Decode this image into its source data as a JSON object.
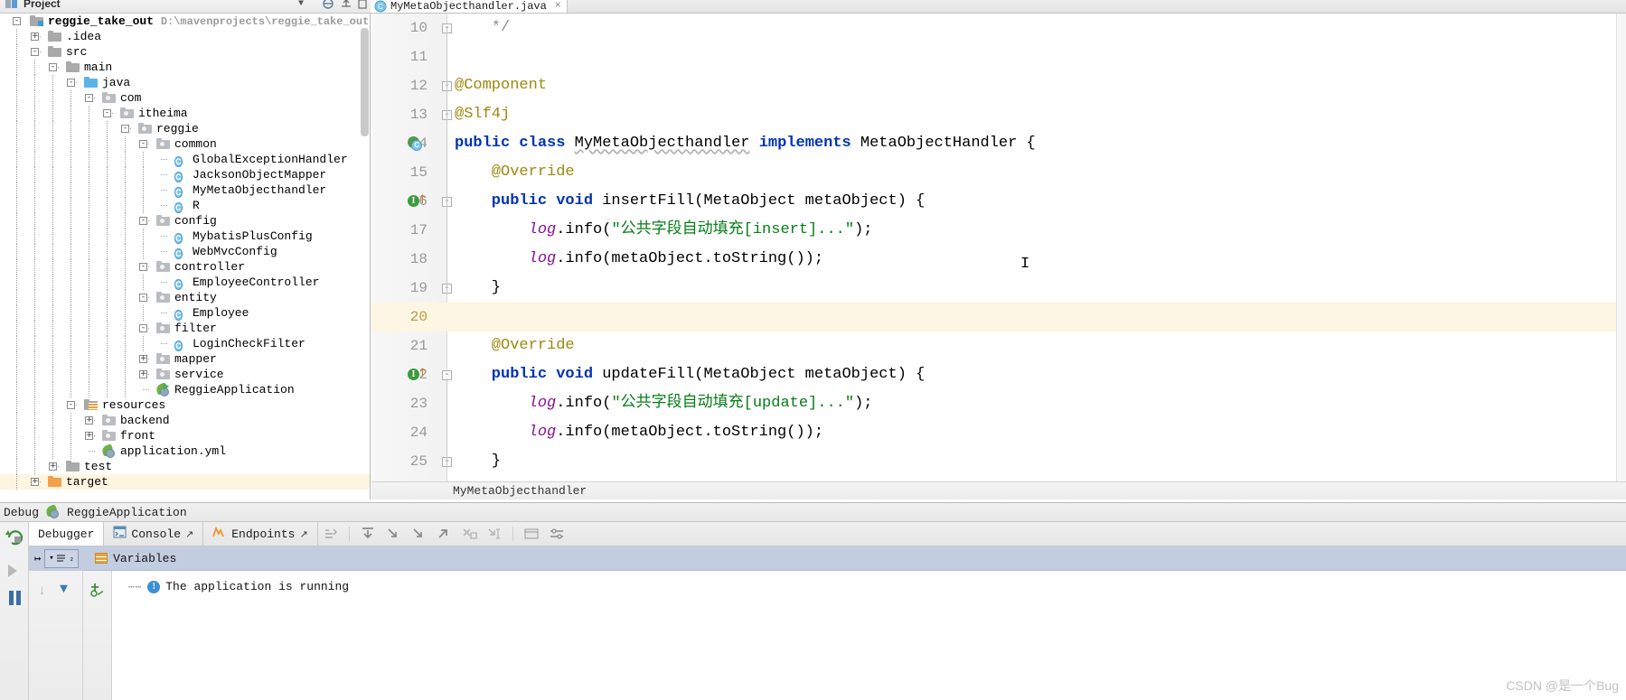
{
  "tool_window": {
    "title": "Project",
    "chevron": "▼",
    "icons": [
      "project-icon",
      "collapse-icon",
      "settings-icon",
      "hide-icon"
    ]
  },
  "editor_tab": {
    "filename": "MyMetaObjecthandler.java",
    "icon": "java-class-icon",
    "close": "×"
  },
  "tree": {
    "rows": [
      {
        "label": "reggie_take_out",
        "path": "D:\\mavenprojects\\reggie_take_out",
        "depth": 0,
        "icon": "module-folder-icon",
        "toggle": "-",
        "bold": true
      },
      {
        "label": ".idea",
        "depth": 1,
        "icon": "folder-gray-icon",
        "toggle": "+"
      },
      {
        "label": "src",
        "depth": 1,
        "icon": "folder-gray-icon",
        "toggle": "-"
      },
      {
        "label": "main",
        "depth": 2,
        "icon": "folder-gray-icon",
        "toggle": "-"
      },
      {
        "label": "java",
        "depth": 3,
        "icon": "source-root-icon",
        "toggle": "-"
      },
      {
        "label": "com",
        "depth": 4,
        "icon": "package-icon",
        "toggle": "-"
      },
      {
        "label": "itheima",
        "depth": 5,
        "icon": "package-icon",
        "toggle": "-"
      },
      {
        "label": "reggie",
        "depth": 6,
        "icon": "package-icon",
        "toggle": "-"
      },
      {
        "label": "common",
        "depth": 7,
        "icon": "package-icon",
        "toggle": "-"
      },
      {
        "label": "GlobalExceptionHandler",
        "depth": 8,
        "icon": "java-class-icon"
      },
      {
        "label": "JacksonObjectMapper",
        "depth": 8,
        "icon": "java-class-icon"
      },
      {
        "label": "MyMetaObjecthandler",
        "depth": 8,
        "icon": "java-class-icon"
      },
      {
        "label": "R",
        "depth": 8,
        "icon": "java-class-icon"
      },
      {
        "label": "config",
        "depth": 7,
        "icon": "package-icon",
        "toggle": "-"
      },
      {
        "label": "MybatisPlusConfig",
        "depth": 8,
        "icon": "java-class-icon"
      },
      {
        "label": "WebMvcConfig",
        "depth": 8,
        "icon": "java-class-icon"
      },
      {
        "label": "controller",
        "depth": 7,
        "icon": "package-icon",
        "toggle": "-"
      },
      {
        "label": "EmployeeController",
        "depth": 8,
        "icon": "java-class-icon"
      },
      {
        "label": "entity",
        "depth": 7,
        "icon": "package-icon",
        "toggle": "-"
      },
      {
        "label": "Employee",
        "depth": 8,
        "icon": "java-class-icon"
      },
      {
        "label": "filter",
        "depth": 7,
        "icon": "package-icon",
        "toggle": "-"
      },
      {
        "label": "LoginCheckFilter",
        "depth": 8,
        "icon": "java-class-icon"
      },
      {
        "label": "mapper",
        "depth": 7,
        "icon": "package-icon",
        "toggle": "+"
      },
      {
        "label": "service",
        "depth": 7,
        "icon": "package-icon",
        "toggle": "+"
      },
      {
        "label": "ReggieApplication",
        "depth": 7,
        "icon": "spring-boot-run-icon"
      },
      {
        "label": "resources",
        "depth": 3,
        "icon": "resources-root-icon",
        "toggle": "-"
      },
      {
        "label": "backend",
        "depth": 4,
        "icon": "package-icon",
        "toggle": "+"
      },
      {
        "label": "front",
        "depth": 4,
        "icon": "package-icon",
        "toggle": "+"
      },
      {
        "label": "application.yml",
        "depth": 4,
        "icon": "spring-yaml-icon"
      },
      {
        "label": "test",
        "depth": 2,
        "icon": "folder-gray-icon",
        "toggle": "+"
      },
      {
        "label": "target",
        "depth": 1,
        "icon": "folder-orange-icon",
        "toggle": "+",
        "selected": true
      }
    ]
  },
  "code": {
    "lines": [
      {
        "n": "10",
        "fold": "-",
        "tokens": [
          {
            "t": "*/",
            "c": "cm",
            "indent": 4
          }
        ]
      },
      {
        "n": "11",
        "tokens": []
      },
      {
        "n": "12",
        "fold": "-",
        "tokens": [
          {
            "t": "@Component",
            "c": "an",
            "indent": 0
          }
        ]
      },
      {
        "n": "13",
        "fold": "-",
        "tokens": [
          {
            "t": "@Slf4j",
            "c": "an",
            "indent": 0
          }
        ]
      },
      {
        "n": "14",
        "gutter": "implemented-class-icon",
        "tokens": [
          {
            "t": "public ",
            "c": "k",
            "indent": 0
          },
          {
            "t": "class ",
            "c": "k"
          },
          {
            "t": "MyMetaObjecthandler",
            "c": "wavy"
          },
          {
            "t": " "
          },
          {
            "t": "implements ",
            "c": "k"
          },
          {
            "t": "MetaObjectHandler {"
          }
        ]
      },
      {
        "n": "15",
        "tokens": [
          {
            "t": "@Override",
            "c": "an",
            "indent": 4
          }
        ]
      },
      {
        "n": "16",
        "gutter": "override-method-icon",
        "fold": "-",
        "tokens": [
          {
            "t": "public ",
            "c": "k",
            "indent": 4
          },
          {
            "t": "void ",
            "c": "k"
          },
          {
            "t": "insertFill(MetaObject metaObject) {"
          }
        ]
      },
      {
        "n": "17",
        "tokens": [
          {
            "t": "log",
            "c": "lg",
            "indent": 8
          },
          {
            "t": ".info("
          },
          {
            "t": "\"公共字段自动填充[insert]...\"",
            "c": "st"
          },
          {
            "t": ");"
          }
        ]
      },
      {
        "n": "18",
        "tokens": [
          {
            "t": "log",
            "c": "lg",
            "indent": 8
          },
          {
            "t": ".info(metaObject.toString());"
          }
        ]
      },
      {
        "n": "19",
        "fold": "-",
        "tokens": [
          {
            "t": "}",
            "indent": 4
          }
        ]
      },
      {
        "n": "20",
        "current": true,
        "tokens": []
      },
      {
        "n": "21",
        "tokens": [
          {
            "t": "@Override",
            "c": "an",
            "indent": 4
          }
        ]
      },
      {
        "n": "22",
        "gutter": "override-method-icon",
        "fold": "-",
        "tokens": [
          {
            "t": "public ",
            "c": "k",
            "indent": 4
          },
          {
            "t": "void ",
            "c": "k"
          },
          {
            "t": "updateFill(MetaObject metaObject) {"
          }
        ]
      },
      {
        "n": "23",
        "tokens": [
          {
            "t": "log",
            "c": "lg",
            "indent": 8
          },
          {
            "t": ".info("
          },
          {
            "t": "\"公共字段自动填充[update]...\"",
            "c": "st"
          },
          {
            "t": ");"
          }
        ]
      },
      {
        "n": "24",
        "tokens": [
          {
            "t": "log",
            "c": "lg",
            "indent": 8
          },
          {
            "t": ".info(metaObject.toString());"
          }
        ]
      },
      {
        "n": "25",
        "fold": "-",
        "tokens": [
          {
            "t": "}",
            "indent": 4
          }
        ]
      }
    ]
  },
  "breadcrumb": {
    "text": "MyMetaObjecthandler"
  },
  "debug_strip": {
    "title": "Debug",
    "app": "ReggieApplication",
    "icon": "spring-boot-run-icon"
  },
  "debug_panel": {
    "tabs": [
      {
        "label": "Debugger",
        "active": true,
        "icon": ""
      },
      {
        "label": "Console",
        "active": false,
        "icon": "console-icon",
        "pin": "↗"
      },
      {
        "label": "Endpoints",
        "active": false,
        "icon": "endpoints-icon",
        "pin": "↗"
      }
    ],
    "toolbar_icons": [
      "mute-breakpoints-icon",
      "step-over-icon",
      "step-into-icon",
      "force-step-into-icon",
      "step-out-icon",
      "drop-frame-icon",
      "run-to-cursor-icon",
      "evaluate-expression-icon",
      "settings-icon"
    ],
    "rail_icons": [
      "rerun-icon",
      "resume-icon",
      "pause-icon"
    ],
    "variables": {
      "label": "Variables",
      "icon": "variables-icon"
    },
    "frames_icons": [
      "export-icon",
      "thread-select-icon"
    ],
    "console_rail_icons": [
      "scroll-down-icon",
      "filter-icon",
      "add-watch-icon"
    ],
    "console": {
      "message": "The application is running",
      "icon": "info-icon",
      "dots": "⋯⋯"
    }
  },
  "watermark": {
    "text": "CSDN @是一个Bug"
  }
}
